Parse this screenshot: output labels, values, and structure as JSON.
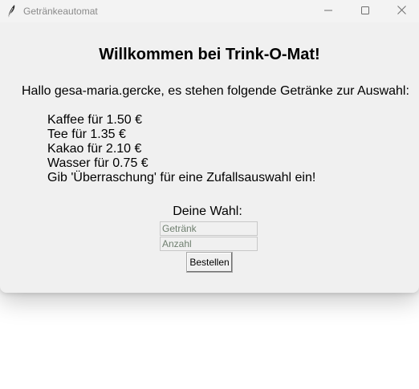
{
  "window": {
    "title": "Getränkeautomat"
  },
  "main": {
    "heading": "Willkommen bei Trink-O-Mat!",
    "greeting": "Hallo gesa-maria.gercke, es stehen folgende Getränke zur Auswahl:",
    "drinks": [
      "Kaffee für 1.50 €",
      "Tee für 1.35 €",
      "Kakao für 2.10 €",
      "Wasser für 0.75 €"
    ],
    "hint": "Gib 'Überraschung' für eine Zufallsauswahl ein!",
    "choice_label": "Deine Wahl:"
  },
  "form": {
    "drink_value": "",
    "drink_placeholder": "Getränk",
    "amount_value": "",
    "amount_placeholder": "Anzahl",
    "order_label": "Bestellen"
  },
  "icons": {
    "app": "feather-icon",
    "minimize": "minimize-icon",
    "maximize": "maximize-icon",
    "close": "close-icon"
  }
}
